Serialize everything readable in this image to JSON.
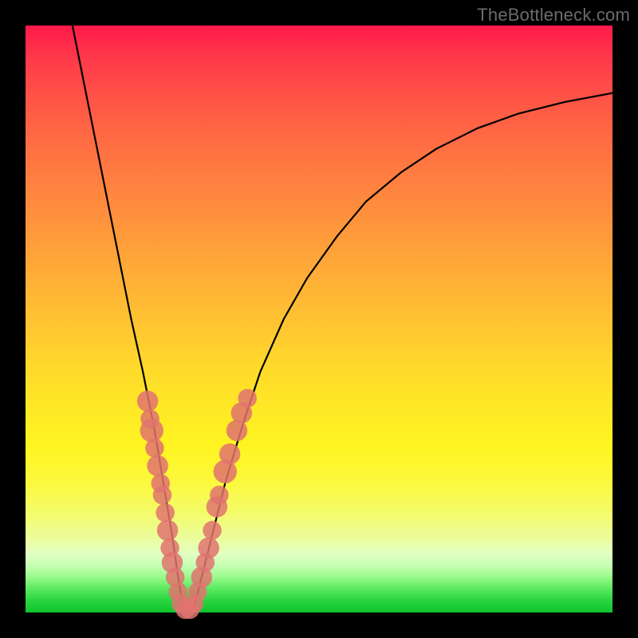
{
  "watermark": {
    "text": "TheBottleneck.com"
  },
  "colors": {
    "curve": "#000000",
    "markers": "#e0736f",
    "gradient_top": "#ff1a49",
    "gradient_mid": "#ffe024",
    "gradient_bottom": "#0fc52e",
    "frame": "#000000"
  },
  "chart_data": {
    "type": "line",
    "title": "",
    "xlabel": "",
    "ylabel": "",
    "xlim": [
      0,
      100
    ],
    "ylim": [
      0,
      100
    ],
    "grid": false,
    "series": [
      {
        "name": "bottleneck-curve",
        "x": [
          8,
          10,
          12,
          14,
          16,
          18,
          20,
          22,
          23.5,
          25,
          26,
          27,
          28.5,
          30,
          32,
          34,
          37,
          40,
          44,
          48,
          53,
          58,
          64,
          70,
          77,
          84,
          92,
          100
        ],
        "y": [
          100,
          90,
          80,
          70,
          60,
          50,
          41,
          31,
          22,
          13,
          6,
          0,
          0,
          6,
          14,
          22,
          32,
          41,
          50,
          57,
          64,
          70,
          75,
          79,
          82.5,
          85,
          87,
          88.5
        ]
      }
    ],
    "markers": [
      {
        "x": 20.8,
        "y": 36,
        "r": 1.8
      },
      {
        "x": 21.2,
        "y": 33,
        "r": 1.6
      },
      {
        "x": 21.5,
        "y": 31,
        "r": 2.0
      },
      {
        "x": 22.0,
        "y": 28,
        "r": 1.6
      },
      {
        "x": 22.5,
        "y": 25,
        "r": 1.8
      },
      {
        "x": 23.0,
        "y": 22,
        "r": 1.6
      },
      {
        "x": 23.3,
        "y": 20,
        "r": 1.6
      },
      {
        "x": 23.8,
        "y": 17,
        "r": 1.6
      },
      {
        "x": 24.2,
        "y": 14,
        "r": 1.8
      },
      {
        "x": 24.6,
        "y": 11,
        "r": 1.6
      },
      {
        "x": 25.0,
        "y": 8.5,
        "r": 1.8
      },
      {
        "x": 25.5,
        "y": 6,
        "r": 1.6
      },
      {
        "x": 26.0,
        "y": 3.5,
        "r": 1.6
      },
      {
        "x": 26.5,
        "y": 1.5,
        "r": 1.6
      },
      {
        "x": 27.2,
        "y": 0.5,
        "r": 1.6
      },
      {
        "x": 28.0,
        "y": 0.5,
        "r": 1.6
      },
      {
        "x": 28.7,
        "y": 1.5,
        "r": 1.6
      },
      {
        "x": 29.3,
        "y": 3.5,
        "r": 1.6
      },
      {
        "x": 30.0,
        "y": 6,
        "r": 1.8
      },
      {
        "x": 30.6,
        "y": 8.5,
        "r": 1.6
      },
      {
        "x": 31.2,
        "y": 11,
        "r": 1.8
      },
      {
        "x": 31.8,
        "y": 14,
        "r": 1.6
      },
      {
        "x": 32.6,
        "y": 18,
        "r": 1.8
      },
      {
        "x": 33.0,
        "y": 20,
        "r": 1.6
      },
      {
        "x": 34.0,
        "y": 24,
        "r": 2.0
      },
      {
        "x": 34.8,
        "y": 27,
        "r": 1.8
      },
      {
        "x": 36.0,
        "y": 31,
        "r": 1.8
      },
      {
        "x": 36.8,
        "y": 34,
        "r": 1.8
      },
      {
        "x": 37.8,
        "y": 36.5,
        "r": 1.6
      }
    ],
    "annotations": []
  }
}
